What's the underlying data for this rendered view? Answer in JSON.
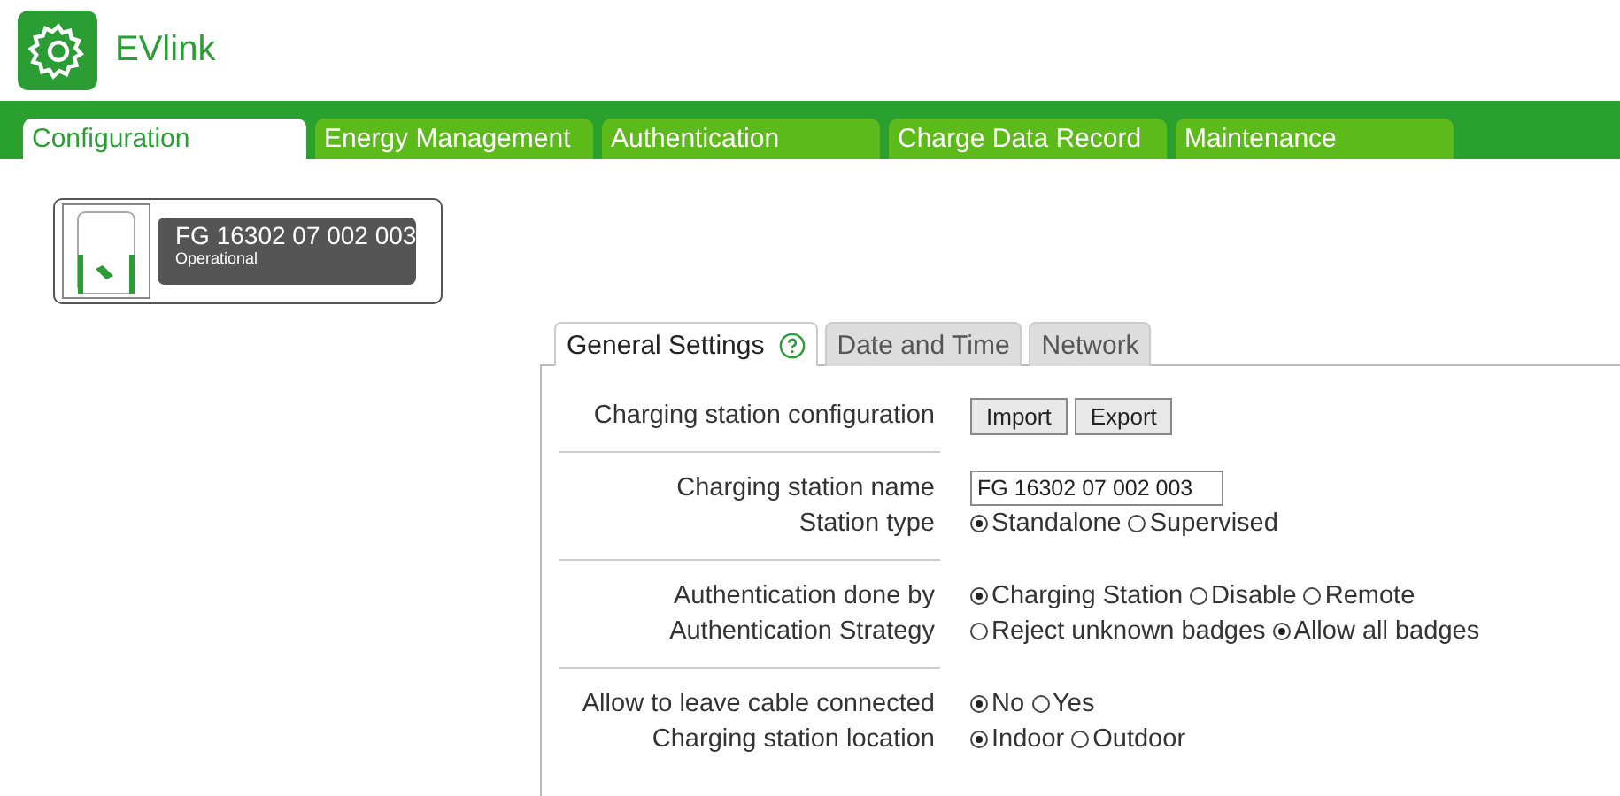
{
  "app": {
    "title": "EVlink"
  },
  "tabs": [
    {
      "label": "Configuration",
      "selected": true
    },
    {
      "label": "Energy Management",
      "selected": false
    },
    {
      "label": "Authentication",
      "selected": false
    },
    {
      "label": "Charge Data Record",
      "selected": false
    },
    {
      "label": "Maintenance",
      "selected": false
    }
  ],
  "station": {
    "name": "FG 16302 07 002 003",
    "status": "Operational"
  },
  "subtabs": [
    {
      "label": "General Settings",
      "selected": true,
      "help": true
    },
    {
      "label": "Date and Time",
      "selected": false,
      "help": false
    },
    {
      "label": "Network",
      "selected": false,
      "help": false
    }
  ],
  "sections": [
    {
      "rows": [
        {
          "label": "Charging station configuration",
          "kind": "buttons",
          "buttons": [
            "Import",
            "Export"
          ]
        }
      ]
    },
    {
      "rows": [
        {
          "label": "Charging station name",
          "kind": "text",
          "value": "FG 16302 07 002 003"
        },
        {
          "label": "Station type",
          "kind": "radio",
          "options": [
            {
              "label": "Standalone",
              "selected": true
            },
            {
              "label": "Supervised",
              "selected": false
            }
          ]
        }
      ]
    },
    {
      "rows": [
        {
          "label": "Authentication done by",
          "kind": "radio",
          "options": [
            {
              "label": "Charging Station",
              "selected": true
            },
            {
              "label": "Disable",
              "selected": false
            },
            {
              "label": "Remote",
              "selected": false
            }
          ]
        },
        {
          "label": "Authentication Strategy",
          "kind": "radio",
          "options": [
            {
              "label": "Reject unknown badges",
              "selected": false
            },
            {
              "label": "Allow all badges",
              "selected": true
            }
          ]
        }
      ]
    },
    {
      "rows": [
        {
          "label": "Allow to leave cable connected",
          "kind": "radio",
          "options": [
            {
              "label": "No",
              "selected": true
            },
            {
              "label": "Yes",
              "selected": false
            }
          ]
        },
        {
          "label": "Charging station location",
          "kind": "radio",
          "options": [
            {
              "label": "Indoor",
              "selected": true
            },
            {
              "label": "Outdoor",
              "selected": false
            }
          ]
        }
      ]
    }
  ]
}
